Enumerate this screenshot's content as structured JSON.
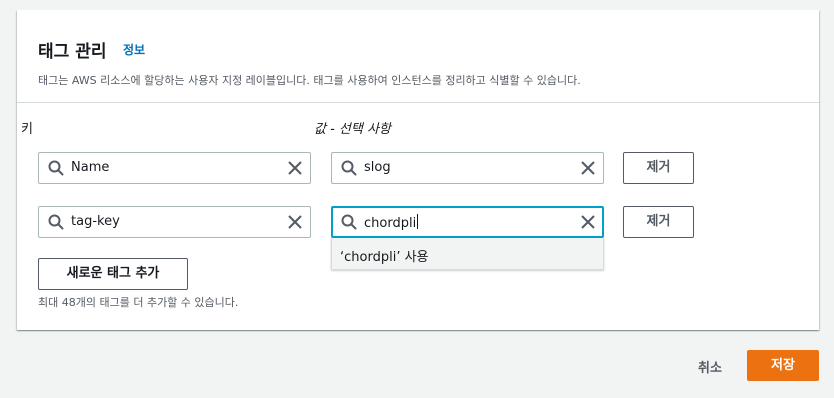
{
  "section": {
    "title": "태그 관리",
    "info_link": "정보",
    "description": "태그는 AWS 리소스에 할당하는 사용자 지정 레이블입니다. 태그를 사용하여 인스턴스를 정리하고 식별할 수 있습니다."
  },
  "labels": {
    "key": "키",
    "value": "값 - 선택 사항"
  },
  "tags": [
    {
      "key": "Name",
      "value": "slog",
      "remove_label": "제거"
    },
    {
      "key": "tag-key",
      "value": "chordpli",
      "remove_label": "제거"
    }
  ],
  "suggestion": "‘chordpli’ 사용",
  "add_button": "새로운 태그 추가",
  "hint": "최대 48개의 태그를 더 추가할 수 있습니다.",
  "footer": {
    "cancel": "취소",
    "save": "저장"
  },
  "colors": {
    "primary_button": "#ec7211",
    "link": "#0073bb",
    "focus_border": "#00a1c9"
  }
}
